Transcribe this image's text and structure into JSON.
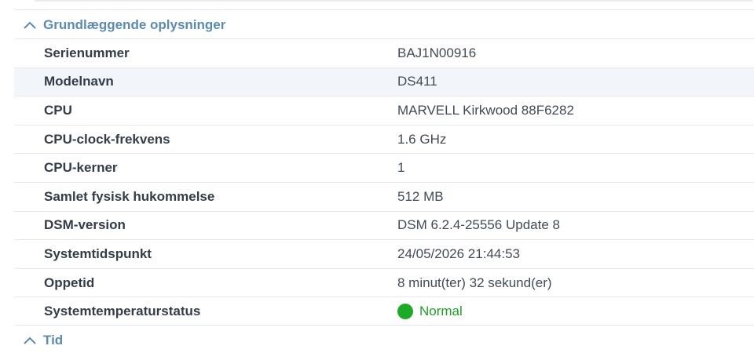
{
  "sections": [
    {
      "title": "Grundlæggende oplysninger",
      "expanded": true
    },
    {
      "title": "Tid",
      "expanded": true
    }
  ],
  "rows": [
    {
      "key": "Serienummer",
      "value": "BAJ1N00916"
    },
    {
      "key": "Modelnavn",
      "value": "DS411"
    },
    {
      "key": "CPU",
      "value": "MARVELL Kirkwood 88F6282"
    },
    {
      "key": "CPU-clock-frekvens",
      "value": "1.6 GHz"
    },
    {
      "key": "CPU-kerner",
      "value": "1"
    },
    {
      "key": "Samlet fysisk hukommelse",
      "value": "512 MB"
    },
    {
      "key": "DSM-version",
      "value": "DSM 6.2.4-25556 Update 8"
    },
    {
      "key": "Systemtidspunkt",
      "value": "24/05/2026 21:44:53"
    },
    {
      "key": "Oppetid",
      "value": "8 minut(ter) 32 sekund(er)"
    },
    {
      "key": "Systemtemperaturstatus",
      "value": "Normal",
      "status_color": "#1eaa28"
    }
  ],
  "colors": {
    "section_title": "#5c8bb0",
    "row_hover": "#f2f6fb",
    "status_ok": "#1eaa28"
  },
  "icons": {
    "section_toggle": "chevron-up-icon",
    "status": "status-dot-icon"
  }
}
